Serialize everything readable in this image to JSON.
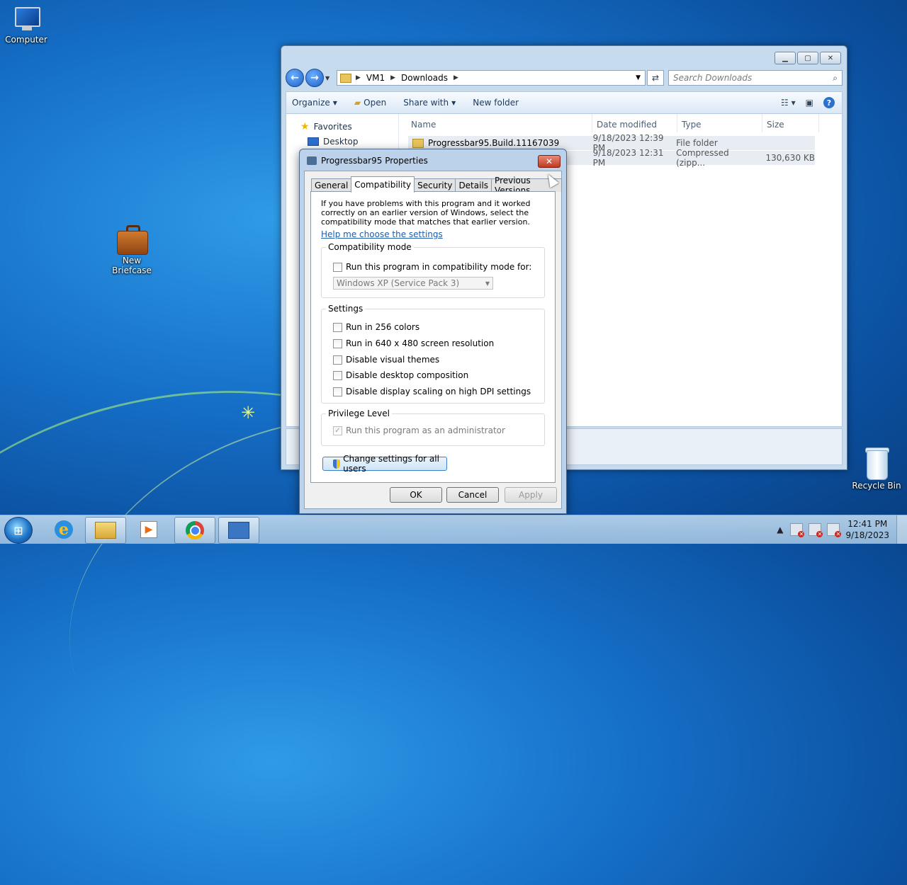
{
  "desktop": {
    "icons": {
      "computer": "Computer",
      "briefcase_line1": "New",
      "briefcase_line2": "Briefcase",
      "recycle_bin": "Recycle Bin"
    }
  },
  "explorer": {
    "breadcrumb": [
      "VM1",
      "Downloads"
    ],
    "search_placeholder": "Search Downloads",
    "toolbar": {
      "organize": "Organize",
      "open": "Open",
      "share_with": "Share with",
      "new_folder": "New folder"
    },
    "nav": {
      "favorites": "Favorites",
      "desktop": "Desktop"
    },
    "columns": {
      "name": "Name",
      "date": "Date modified",
      "type": "Type",
      "size": "Size"
    },
    "rows": [
      {
        "name": "Progressbar95.Build.11167039",
        "date": "9/18/2023 12:39 PM",
        "type": "File folder",
        "size": ""
      },
      {
        "name": "",
        "date": "9/18/2023 12:31 PM",
        "type": "Compressed (zipp...",
        "size": "130,630 KB"
      }
    ]
  },
  "dialog": {
    "title": "Progressbar95 Properties",
    "tabs": [
      "General",
      "Compatibility",
      "Security",
      "Details",
      "Previous Versions"
    ],
    "intro": "If you have problems with this program and it worked correctly on an earlier version of Windows, select the compatibility mode that matches that earlier version.",
    "help_link": "Help me choose the settings",
    "compat_group": "Compatibility mode",
    "compat_check": "Run this program in compatibility mode for:",
    "compat_select": "Windows XP (Service Pack 3)",
    "settings_group": "Settings",
    "settings": [
      "Run in 256 colors",
      "Run in 640 x 480 screen resolution",
      "Disable visual themes",
      "Disable desktop composition",
      "Disable display scaling on high DPI settings"
    ],
    "privilege_group": "Privilege Level",
    "privilege_check": "Run this program as an administrator",
    "all_users_button": "Change settings for all users",
    "buttons": {
      "ok": "OK",
      "cancel": "Cancel",
      "apply": "Apply"
    }
  },
  "taskbar": {
    "time": "12:41 PM",
    "date": "9/18/2023"
  }
}
